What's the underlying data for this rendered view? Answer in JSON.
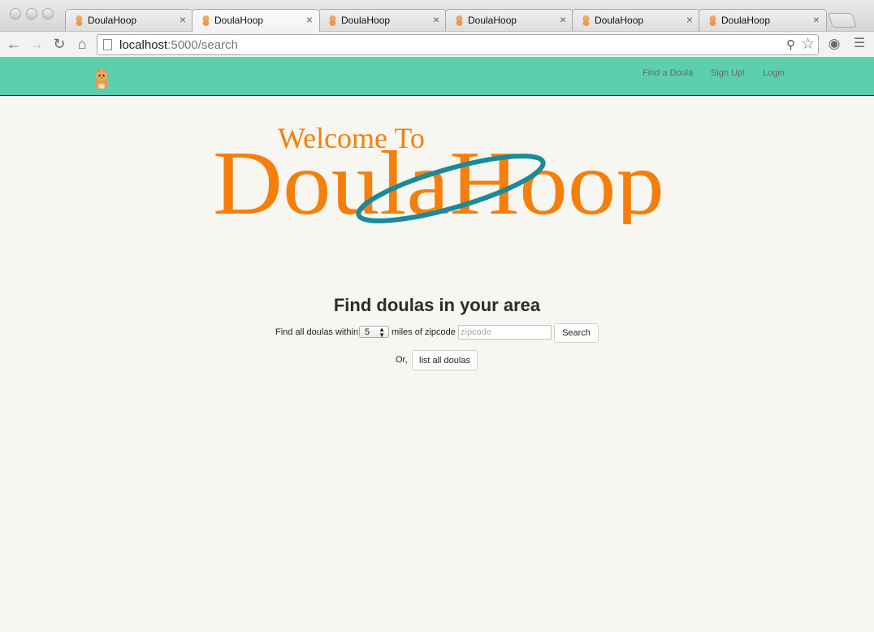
{
  "browser": {
    "tabs": [
      {
        "title": "DoulaHoop",
        "active": false
      },
      {
        "title": "DoulaHoop",
        "active": true
      },
      {
        "title": "DoulaHoop",
        "active": false
      },
      {
        "title": "DoulaHoop",
        "active": false
      },
      {
        "title": "DoulaHoop",
        "active": false
      },
      {
        "title": "DoulaHoop",
        "active": false
      }
    ],
    "url_host": "localhost",
    "url_rest": ":5000/search",
    "icons": {
      "back": "back-arrow-icon",
      "forward": "forward-arrow-icon",
      "reload": "reload-icon",
      "home": "home-icon",
      "zoom": "magnifier-icon",
      "bookmark": "star-icon",
      "extension": "compass-icon",
      "menu": "hamburger-menu-icon"
    }
  },
  "navbar": {
    "color": "#5ccfad",
    "brand_icon": "kitten-logo",
    "links": {
      "find": "Find a Doula",
      "signup": "Sign Up!",
      "login": "Login"
    }
  },
  "logo": {
    "welcome": "Welcome To",
    "brand": "DoulaHoop",
    "orange": "#f57f0a",
    "hoop": "#1a8a9a"
  },
  "search": {
    "headline": "Find doulas in your area",
    "prefix": "Find all doulas within",
    "miles_value": "5",
    "middle": "miles of zipcode",
    "zip_placeholder": "zipcode",
    "search_button": "Search",
    "or_label": "Or,",
    "list_button": "list all doulas"
  }
}
